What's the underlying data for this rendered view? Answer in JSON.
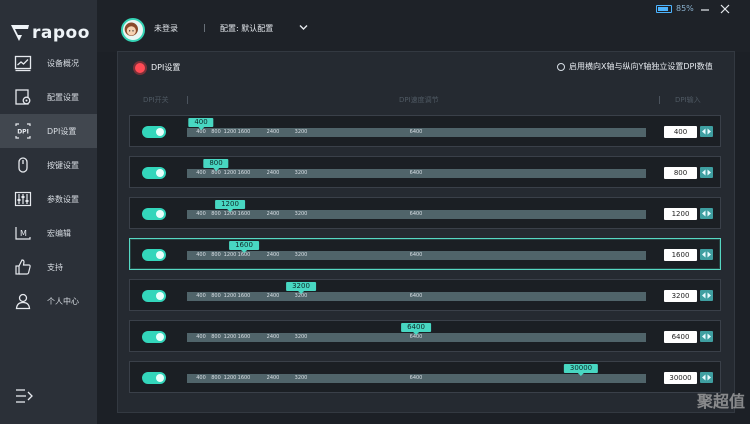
{
  "brand": {
    "name": "rapoo"
  },
  "nav": {
    "items": [
      {
        "label": "设备概况",
        "icon": "chart-icon"
      },
      {
        "label": "配置设置",
        "icon": "profile-icon"
      },
      {
        "label": "DPI设置",
        "icon": "dpi-icon"
      },
      {
        "label": "按键设置",
        "icon": "mouse-icon"
      },
      {
        "label": "参数设置",
        "icon": "sliders-icon"
      },
      {
        "label": "宏编辑",
        "icon": "macro-icon"
      },
      {
        "label": "支持",
        "icon": "thumbs-up-icon"
      },
      {
        "label": "个人中心",
        "icon": "user-icon"
      }
    ],
    "active_index": 2
  },
  "header": {
    "user": "未登录",
    "sep": "|",
    "config": "配置: 默认配置"
  },
  "battery": {
    "percent_text": "85%",
    "level": 0.85
  },
  "panel": {
    "title": "DPI设置",
    "independent_label": "启用横向X轴与纵向Y轴独立设置DPI数值",
    "columns": {
      "switch": "DPI开关",
      "adjust": "DPI速度调节",
      "input": "DPI输入"
    }
  },
  "dpi": {
    "ticks": [
      "400",
      "800",
      "1200",
      "1600",
      "2400",
      "3200",
      "6400"
    ],
    "rows": [
      {
        "value": "400",
        "enabled": true
      },
      {
        "value": "800",
        "enabled": true
      },
      {
        "value": "1200",
        "enabled": true
      },
      {
        "value": "1600",
        "enabled": true
      },
      {
        "value": "3200",
        "enabled": true
      },
      {
        "value": "6400",
        "enabled": true
      },
      {
        "value": "30000",
        "enabled": true
      }
    ],
    "active_row": 3
  },
  "watermark": "聚超值",
  "colors": {
    "accent": "#33d6bb",
    "indicator": "#ff4b55"
  }
}
